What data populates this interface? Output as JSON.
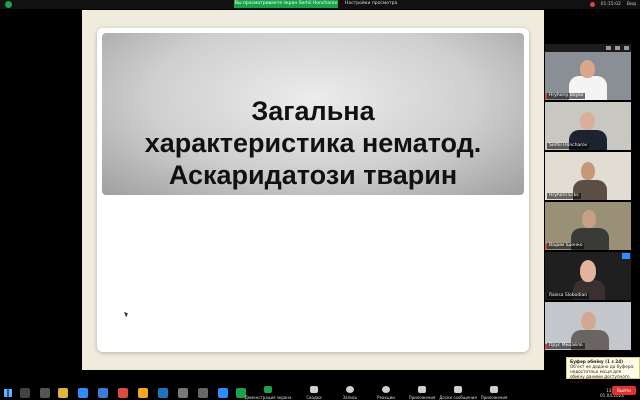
{
  "top_bar": {
    "share_banner": "Вы просматриваете экран Serhii Honcharov",
    "view_options": "Настройки просмотра",
    "clock": "01:15:02",
    "view_label": "Вид"
  },
  "slide": {
    "title_lines": [
      "Загальна",
      "характеристика нематод.",
      "Аскаридатози тварин"
    ]
  },
  "participants": [
    {
      "name": "Hryhoriy Boyko",
      "muted": true
    },
    {
      "name": "Serhii Honcharov",
      "muted": false
    },
    {
      "name": "Hryhorii Ecks",
      "muted": false
    },
    {
      "name": "Вадим Іщенко",
      "muted": true
    },
    {
      "name": "Raissa Slobodian",
      "muted": false
    },
    {
      "name": "Прус Михайло",
      "muted": true
    }
  ],
  "clipboard_popup": {
    "title": "Буфер обміну (1 з 24)",
    "text": "Об'єкт не додано до буфера: недостатньо місця для обміну даними доступного місця"
  },
  "controls": [
    {
      "name": "share",
      "label": "Демонстрация экрана"
    },
    {
      "name": "chat",
      "label": "Сводка"
    },
    {
      "name": "record",
      "label": "Запись"
    },
    {
      "name": "reactions",
      "label": "Реакции"
    },
    {
      "name": "apps",
      "label": "Приложения"
    },
    {
      "name": "whiteboard",
      "label": "Доски сообщения"
    },
    {
      "name": "more",
      "label": "Приложения"
    }
  ],
  "end_button": "Выйти",
  "tray": {
    "time": "13:01",
    "date": "01.04.2023"
  },
  "colors": {
    "accent": "#1aa34a",
    "end": "#e03030",
    "stage_bg": "#efebdd"
  }
}
